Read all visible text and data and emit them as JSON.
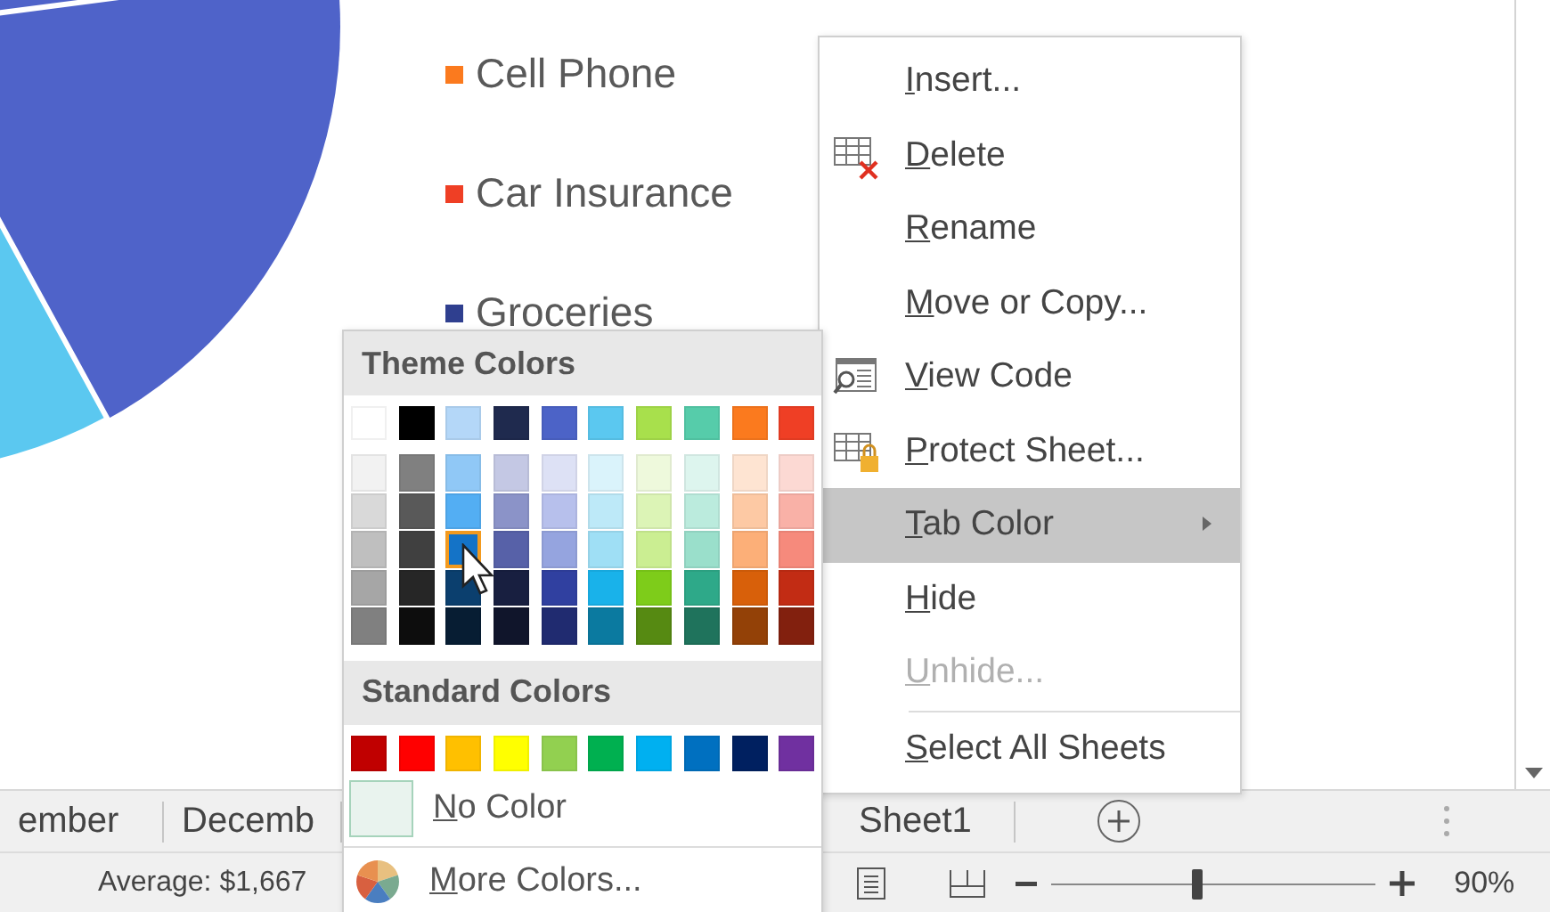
{
  "chart": {
    "legend": [
      {
        "label": "Cell Phone",
        "color": "#fb7a1e"
      },
      {
        "label": "Car Insurance",
        "color": "#ef3f25"
      },
      {
        "label": "Groceries",
        "color": "#2f3f8f"
      }
    ]
  },
  "context_menu": {
    "items": [
      {
        "label": "Insert...",
        "kind": "plain",
        "highlighted": false,
        "disabled": false,
        "submenu": false
      },
      {
        "label": "Delete",
        "kind": "grid-x",
        "highlighted": false,
        "disabled": false,
        "submenu": false
      },
      {
        "label": "Rename",
        "kind": "plain",
        "highlighted": false,
        "disabled": false,
        "submenu": false
      },
      {
        "label": "Move or Copy...",
        "kind": "plain",
        "highlighted": false,
        "disabled": false,
        "submenu": false
      },
      {
        "label": "View Code",
        "kind": "code",
        "highlighted": false,
        "disabled": false,
        "submenu": false
      },
      {
        "label": "Protect Sheet...",
        "kind": "grid-lock",
        "highlighted": false,
        "disabled": false,
        "submenu": false
      },
      {
        "label": "Tab Color",
        "kind": "plain",
        "highlighted": true,
        "disabled": false,
        "submenu": true
      },
      {
        "label": "Hide",
        "kind": "plain",
        "highlighted": false,
        "disabled": false,
        "submenu": false
      },
      {
        "label": "Unhide...",
        "kind": "plain",
        "highlighted": false,
        "disabled": true,
        "submenu": false
      },
      {
        "kind": "separator"
      },
      {
        "label": "Select All Sheets",
        "kind": "plain",
        "highlighted": false,
        "disabled": false,
        "submenu": false
      }
    ]
  },
  "tab_color_palette": {
    "theme_title": "Theme Colors",
    "theme_base": [
      {
        "color": "#ffffff",
        "selected": false
      },
      {
        "color": "#000000",
        "selected": false
      },
      {
        "color": "#b4d7f8",
        "selected": false
      },
      {
        "color": "#1f2a4e",
        "selected": false
      },
      {
        "color": "#4c63c7",
        "selected": false
      },
      {
        "color": "#5bc8f0",
        "selected": false
      },
      {
        "color": "#a8e04c",
        "selected": false
      },
      {
        "color": "#56ccaa",
        "selected": false
      },
      {
        "color": "#fb7a1e",
        "selected": false
      },
      {
        "color": "#ef3f25",
        "selected": false
      }
    ],
    "theme_shades": [
      [
        {
          "color": "#f2f2f2",
          "selected": false
        },
        {
          "color": "#d9d9d9",
          "selected": false
        },
        {
          "color": "#bfbfbf",
          "selected": false
        },
        {
          "color": "#a6a6a6",
          "selected": false
        },
        {
          "color": "#808080",
          "selected": false
        }
      ],
      [
        {
          "color": "#808080",
          "selected": false
        },
        {
          "color": "#595959",
          "selected": false
        },
        {
          "color": "#404040",
          "selected": false
        },
        {
          "color": "#262626",
          "selected": false
        },
        {
          "color": "#0d0d0d",
          "selected": false
        }
      ],
      [
        {
          "color": "#90c8f6",
          "selected": false
        },
        {
          "color": "#53aef3",
          "selected": false
        },
        {
          "color": "#1473c7",
          "selected": true
        },
        {
          "color": "#0b3f6e",
          "selected": false
        },
        {
          "color": "#071d33",
          "selected": false
        }
      ],
      [
        {
          "color": "#c4c8e4",
          "selected": false
        },
        {
          "color": "#8b93c8",
          "selected": false
        },
        {
          "color": "#5761a8",
          "selected": false
        },
        {
          "color": "#181f40",
          "selected": false
        },
        {
          "color": "#10152b",
          "selected": false
        }
      ],
      [
        {
          "color": "#dde1f5",
          "selected": false
        },
        {
          "color": "#b7c0ec",
          "selected": false
        },
        {
          "color": "#95a4df",
          "selected": false
        },
        {
          "color": "#3040a0",
          "selected": false
        },
        {
          "color": "#202b70",
          "selected": false
        }
      ],
      [
        {
          "color": "#daf3fb",
          "selected": false
        },
        {
          "color": "#bde9f8",
          "selected": false
        },
        {
          "color": "#9fdff5",
          "selected": false
        },
        {
          "color": "#19b2ea",
          "selected": false
        },
        {
          "color": "#0b7aa0",
          "selected": false
        }
      ],
      [
        {
          "color": "#eef9dc",
          "selected": false
        },
        {
          "color": "#dcf4b6",
          "selected": false
        },
        {
          "color": "#cbee92",
          "selected": false
        },
        {
          "color": "#7ecc1a",
          "selected": false
        },
        {
          "color": "#568a12",
          "selected": false
        }
      ],
      [
        {
          "color": "#ddf5ee",
          "selected": false
        },
        {
          "color": "#bbebdd",
          "selected": false
        },
        {
          "color": "#9adfcb",
          "selected": false
        },
        {
          "color": "#2ea989",
          "selected": false
        },
        {
          "color": "#1f735c",
          "selected": false
        }
      ],
      [
        {
          "color": "#fee4d2",
          "selected": false
        },
        {
          "color": "#fdc9a4",
          "selected": false
        },
        {
          "color": "#fcaf78",
          "selected": false
        },
        {
          "color": "#d8600a",
          "selected": false
        },
        {
          "color": "#934107",
          "selected": false
        }
      ],
      [
        {
          "color": "#fcd9d3",
          "selected": false
        },
        {
          "color": "#f9b1a7",
          "selected": false
        },
        {
          "color": "#f68a7c",
          "selected": false
        },
        {
          "color": "#c22c14",
          "selected": false
        },
        {
          "color": "#82200e",
          "selected": false
        }
      ]
    ],
    "standard_title": "Standard Colors",
    "standard": [
      {
        "color": "#c00000",
        "selected": false
      },
      {
        "color": "#ff0000",
        "selected": false
      },
      {
        "color": "#ffc000",
        "selected": false
      },
      {
        "color": "#ffff00",
        "selected": false
      },
      {
        "color": "#92d050",
        "selected": false
      },
      {
        "color": "#00b050",
        "selected": false
      },
      {
        "color": "#00b0f0",
        "selected": false
      },
      {
        "color": "#0070c0",
        "selected": false
      },
      {
        "color": "#002060",
        "selected": false
      },
      {
        "color": "#7030a0",
        "selected": false
      }
    ],
    "no_color": "No Color",
    "more_colors": "More Colors..."
  },
  "sheet_tabs": [
    {
      "label": "ember"
    },
    {
      "label": "Decemb"
    },
    {
      "label": "Sheet1"
    }
  ],
  "status_bar": {
    "average": "Average: $1,667",
    "zoom": {
      "level": 0.45,
      "reading": "90%"
    }
  }
}
